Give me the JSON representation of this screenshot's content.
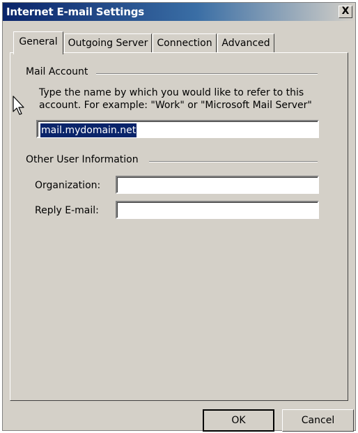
{
  "window": {
    "title": "Internet E-mail Settings",
    "close_label": "X"
  },
  "tabs": [
    {
      "label": "General",
      "active": true
    },
    {
      "label": "Outgoing Server",
      "active": false
    },
    {
      "label": "Connection",
      "active": false
    },
    {
      "label": "Advanced",
      "active": false
    }
  ],
  "mail_account": {
    "group_label": "Mail Account",
    "description": "Type the name by which you would like to refer to this account.  For example: \"Work\" or \"Microsoft Mail Server\"",
    "account_name_value": "mail.mydomain.net"
  },
  "other_user_info": {
    "group_label": "Other User Information",
    "organization_label": "Organization:",
    "organization_value": "",
    "reply_email_label": "Reply E-mail:",
    "reply_email_value": ""
  },
  "buttons": {
    "ok_label": "OK",
    "cancel_label": "Cancel"
  },
  "colors": {
    "title_bar": "#0a246a",
    "dialog_face": "#d4d0c8",
    "selection": "#0a246a"
  }
}
